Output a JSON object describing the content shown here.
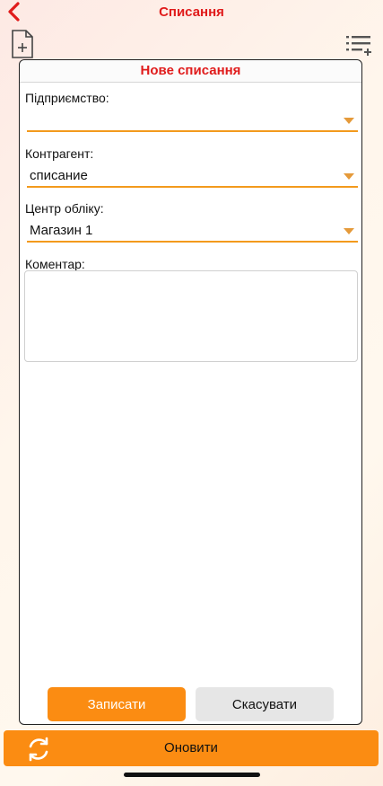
{
  "header": {
    "title": "Списання"
  },
  "form": {
    "title": "Нове списання",
    "enterprise": {
      "label": "Підприємство:",
      "value": ""
    },
    "counterparty": {
      "label": "Контрагент:",
      "value": "списание"
    },
    "account_center": {
      "label": "Центр обліку:",
      "value": "Магазин 1"
    },
    "comment": {
      "label": "Коментар:",
      "value": ""
    },
    "save_label": "Записати",
    "cancel_label": "Скасувати"
  },
  "footer": {
    "refresh_label": "Оновити"
  },
  "colors": {
    "accent": "#fb8c12",
    "title_red": "#e01b1b",
    "underline": "#f39a1d"
  },
  "icons": {
    "back": "chevron-left-icon",
    "new_document": "new-document-icon",
    "list_add": "list-add-icon",
    "refresh": "refresh-icon"
  }
}
